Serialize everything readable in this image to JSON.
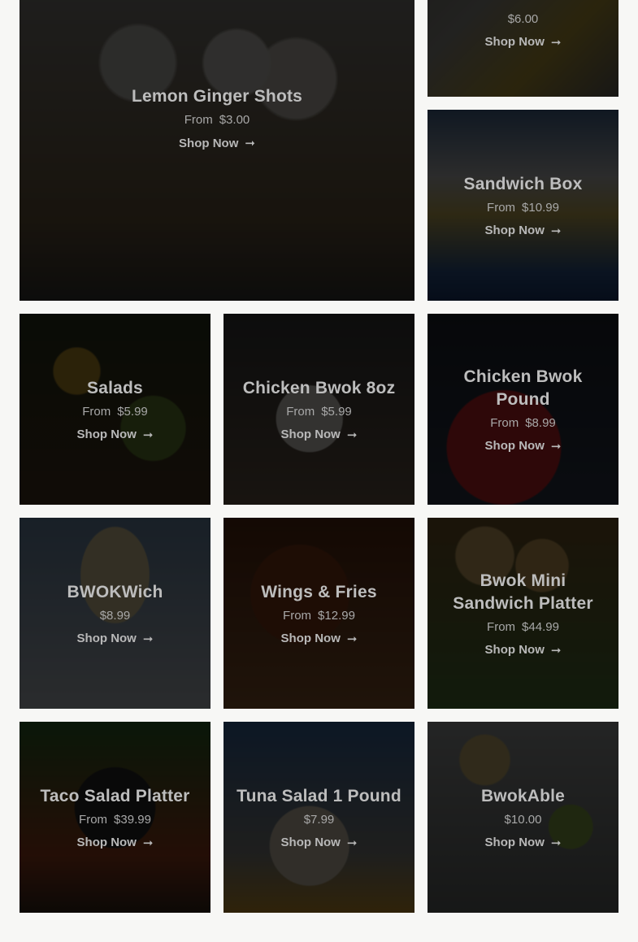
{
  "shop_label": "Shop Now",
  "from_label": "From",
  "products": [
    {
      "id": "lemon-ginger-shots",
      "title": "Lemon Ginger Shots",
      "has_from": true,
      "price": "$3.00"
    },
    {
      "id": "top-right",
      "title": "",
      "has_from": false,
      "price": "$6.00"
    },
    {
      "id": "sandwich-box",
      "title": "Sandwich Box",
      "has_from": true,
      "price": "$10.99"
    },
    {
      "id": "salads",
      "title": "Salads",
      "has_from": true,
      "price": "$5.99"
    },
    {
      "id": "chicken-bwok-8oz",
      "title": "Chicken Bwok 8oz",
      "has_from": true,
      "price": "$5.99"
    },
    {
      "id": "chicken-bwok-pound",
      "title": "Chicken Bwok Pound",
      "has_from": true,
      "price": "$8.99"
    },
    {
      "id": "bwokwich",
      "title": "BWOKWich",
      "has_from": false,
      "price": "$8.99"
    },
    {
      "id": "wings-fries",
      "title": "Wings & Fries",
      "has_from": true,
      "price": "$12.99"
    },
    {
      "id": "bwok-mini-sandwich-platter",
      "title": "Bwok Mini Sandwich Platter",
      "has_from": true,
      "price": "$44.99"
    },
    {
      "id": "taco-salad-platter",
      "title": "Taco Salad Platter",
      "has_from": true,
      "price": "$39.99"
    },
    {
      "id": "tuna-salad-1-pound",
      "title": "Tuna Salad 1 Pound",
      "has_from": false,
      "price": "$7.99"
    },
    {
      "id": "bwokable",
      "title": "BwokAble",
      "has_from": false,
      "price": "$10.00"
    }
  ],
  "overlay_color": "#000000"
}
